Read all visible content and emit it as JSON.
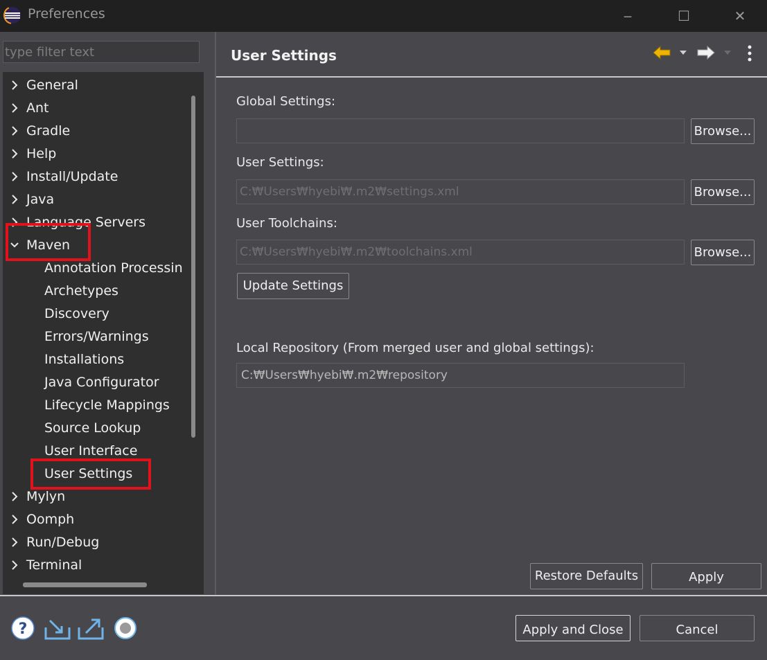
{
  "window": {
    "title": "Preferences",
    "minimize": "‒",
    "maximize": "☐",
    "close": "✕"
  },
  "sidebar": {
    "filter_placeholder": "type filter text",
    "items": [
      {
        "label": "General"
      },
      {
        "label": "Ant"
      },
      {
        "label": "Gradle"
      },
      {
        "label": "Help"
      },
      {
        "label": "Install/Update"
      },
      {
        "label": "Java"
      },
      {
        "label": "Language Servers"
      },
      {
        "label": "Maven"
      },
      {
        "label": "Annotation Processin"
      },
      {
        "label": "Archetypes"
      },
      {
        "label": "Discovery"
      },
      {
        "label": "Errors/Warnings"
      },
      {
        "label": "Installations"
      },
      {
        "label": "Java Configurator"
      },
      {
        "label": "Lifecycle Mappings"
      },
      {
        "label": "Source Lookup"
      },
      {
        "label": "User Interface"
      },
      {
        "label": "User Settings"
      },
      {
        "label": "Mylyn"
      },
      {
        "label": "Oomph"
      },
      {
        "label": "Run/Debug"
      },
      {
        "label": "Terminal"
      }
    ]
  },
  "page": {
    "title": "User Settings",
    "global_settings_label": "Global Settings:",
    "global_settings_value": "",
    "user_settings_label": "User Settings:",
    "user_settings_value": "C:₩Users₩hyebi₩.m2₩settings.xml",
    "user_toolchains_label": "User Toolchains:",
    "user_toolchains_value": "C:₩Users₩hyebi₩.m2₩toolchains.xml",
    "browse_label": "Browse...",
    "update_settings_label": "Update Settings",
    "local_repo_label": "Local Repository (From merged user and global settings):",
    "local_repo_value": "C:₩Users₩hyebi₩.m2₩repository",
    "restore_defaults_label": "Restore Defaults",
    "apply_label": "Apply"
  },
  "footer": {
    "apply_close_label": "Apply and Close",
    "cancel_label": "Cancel"
  },
  "icons": {
    "help": "help-icon",
    "import": "import-icon",
    "export": "export-icon",
    "record": "record-icon",
    "back": "back-arrow-icon",
    "forward": "forward-arrow-icon",
    "menu": "view-menu-icon"
  },
  "colors": {
    "highlight": "#e0121b",
    "back_arrow": "#f0b400"
  }
}
